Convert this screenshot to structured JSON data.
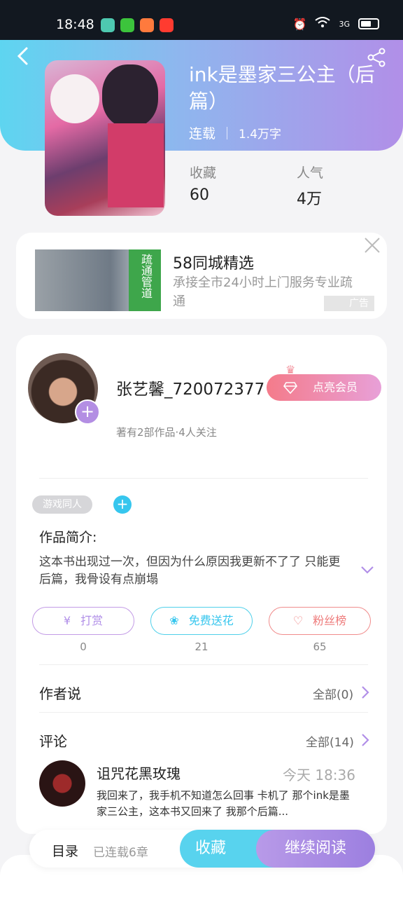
{
  "status_bar": {
    "time": "18:48",
    "network": "3G",
    "app_colors": [
      "#4ec9b0",
      "#3cc43c",
      "#ff7a3d",
      "#ff3b30"
    ]
  },
  "book": {
    "title": "ink是墨家三公主（后篇）",
    "status": "连载",
    "word_count": "1.4万字",
    "stats": [
      {
        "label": "收藏",
        "value": "60"
      },
      {
        "label": "人气",
        "value": "4万"
      }
    ]
  },
  "ad": {
    "title": "58同城精选",
    "description": "承接全市24小时上门服务专业疏通",
    "tag": "广告",
    "image_text": "疏通管道"
  },
  "author": {
    "name": "张艺馨_720072377",
    "meta": "著有2部作品·4人关注",
    "vip_button": "点亮会员"
  },
  "tags": [
    "游戏同人"
  ],
  "intro": {
    "label": "作品简介:",
    "text": "这本书出现过一次，但因为什么原因我更新不了了 只能更后篇，我骨设有点崩塌"
  },
  "actions": [
    {
      "label": "打赏",
      "count": "0",
      "icon": "yen-icon",
      "color": "#c39be6"
    },
    {
      "label": "免费送花",
      "count": "21",
      "icon": "flower-icon",
      "color": "#4fd0ea"
    },
    {
      "label": "粉丝榜",
      "count": "65",
      "icon": "user-heart-icon",
      "color": "#f08c8c"
    }
  ],
  "author_says": {
    "label": "作者说",
    "link": "全部(0)"
  },
  "comments": {
    "label": "评论",
    "link": "全部(14)",
    "first": {
      "user": "诅咒花黑玫瑰",
      "time": "今天 18:36",
      "text": "我回来了，我手机不知道怎么回事 卡机了 那个ink是墨家三公主，这本书又回来了 我那个后篇..."
    }
  },
  "bottom_bar": {
    "toc_label": "目录",
    "toc_meta": "已连载6章",
    "collect": "收藏",
    "read": "继续阅读"
  }
}
